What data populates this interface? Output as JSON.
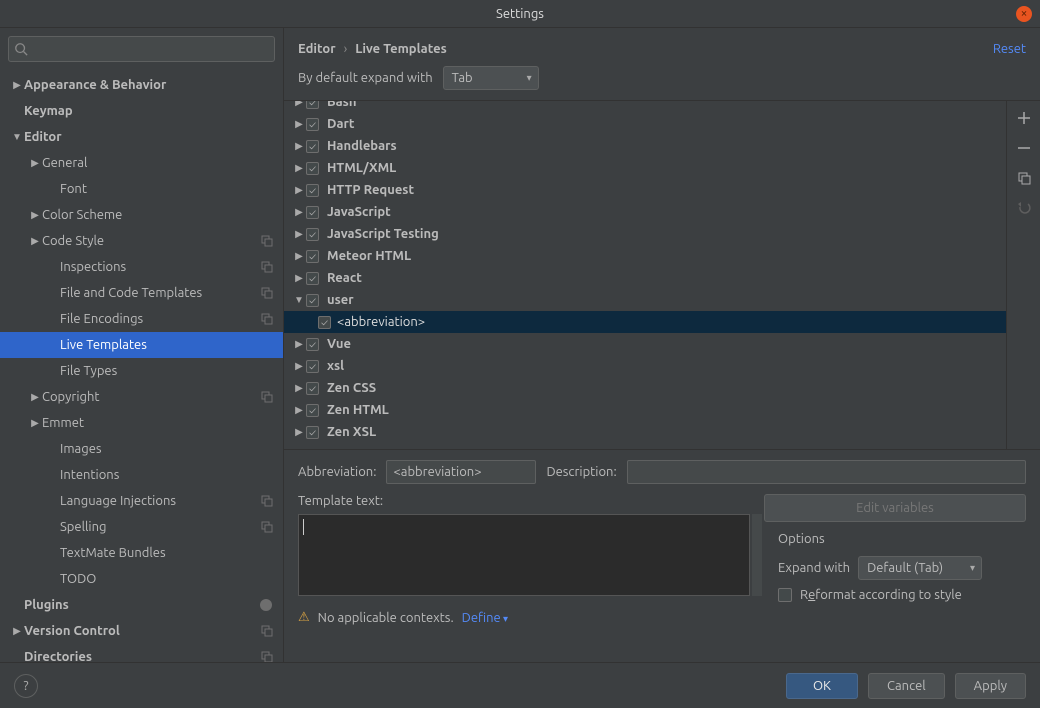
{
  "title": "Settings",
  "breadcrumb": {
    "a": "Editor",
    "b": "Live Templates",
    "reset": "Reset"
  },
  "expand_label": "By default expand with",
  "expand_value": "Tab",
  "sidebar": {
    "search_placeholder": "",
    "items": [
      {
        "label": "Appearance & Behavior",
        "level": 0,
        "arrow": "▶",
        "bold": true
      },
      {
        "label": "Keymap",
        "level": 0,
        "arrow": "",
        "bold": true
      },
      {
        "label": "Editor",
        "level": 0,
        "arrow": "▼",
        "bold": true
      },
      {
        "label": "General",
        "level": 1,
        "arrow": "▶"
      },
      {
        "label": "Font",
        "level": 2,
        "arrow": ""
      },
      {
        "label": "Color Scheme",
        "level": 1,
        "arrow": "▶"
      },
      {
        "label": "Code Style",
        "level": 1,
        "arrow": "▶",
        "copy": true
      },
      {
        "label": "Inspections",
        "level": 2,
        "arrow": "",
        "copy": true
      },
      {
        "label": "File and Code Templates",
        "level": 2,
        "arrow": "",
        "copy": true
      },
      {
        "label": "File Encodings",
        "level": 2,
        "arrow": "",
        "copy": true
      },
      {
        "label": "Live Templates",
        "level": 2,
        "arrow": "",
        "selected": true
      },
      {
        "label": "File Types",
        "level": 2,
        "arrow": ""
      },
      {
        "label": "Copyright",
        "level": 1,
        "arrow": "▶",
        "copy": true
      },
      {
        "label": "Emmet",
        "level": 1,
        "arrow": "▶"
      },
      {
        "label": "Images",
        "level": 2,
        "arrow": ""
      },
      {
        "label": "Intentions",
        "level": 2,
        "arrow": ""
      },
      {
        "label": "Language Injections",
        "level": 2,
        "arrow": "",
        "copy": true
      },
      {
        "label": "Spelling",
        "level": 2,
        "arrow": "",
        "copy": true
      },
      {
        "label": "TextMate Bundles",
        "level": 2,
        "arrow": ""
      },
      {
        "label": "TODO",
        "level": 2,
        "arrow": ""
      },
      {
        "label": "Plugins",
        "level": 0,
        "arrow": "",
        "bold": true,
        "badge": true
      },
      {
        "label": "Version Control",
        "level": 0,
        "arrow": "▶",
        "bold": true,
        "copy": true
      },
      {
        "label": "Directories",
        "level": 0,
        "arrow": "",
        "bold": true,
        "copy": true
      }
    ]
  },
  "groups": [
    {
      "name": "Bash",
      "arrow": "▶",
      "pad": true
    },
    {
      "name": "Dart",
      "arrow": "▶"
    },
    {
      "name": "Handlebars",
      "arrow": "▶"
    },
    {
      "name": "HTML/XML",
      "arrow": "▶"
    },
    {
      "name": "HTTP Request",
      "arrow": "▶"
    },
    {
      "name": "JavaScript",
      "arrow": "▶"
    },
    {
      "name": "JavaScript Testing",
      "arrow": "▶"
    },
    {
      "name": "Meteor HTML",
      "arrow": "▶"
    },
    {
      "name": "React",
      "arrow": "▶"
    },
    {
      "name": "user",
      "arrow": "▼",
      "items": [
        {
          "name": "<abbreviation>",
          "selected": true
        }
      ]
    },
    {
      "name": "Vue",
      "arrow": "▶"
    },
    {
      "name": "xsl",
      "arrow": "▶"
    },
    {
      "name": "Zen CSS",
      "arrow": "▶"
    },
    {
      "name": "Zen HTML",
      "arrow": "▶"
    },
    {
      "name": "Zen XSL",
      "arrow": "▶"
    }
  ],
  "fields": {
    "abbr_label": "Abbreviation:",
    "abbr_value": "<abbreviation>",
    "desc_label": "Description:",
    "desc_value": "",
    "tt_label": "Template text:",
    "edit_vars": "Edit variables",
    "options": "Options",
    "expand_with": "Expand with",
    "expand_with_value": "Default (Tab)",
    "reformat_pre": "R",
    "reformat_mid": "e",
    "reformat_post": "format according to style",
    "warn": "No applicable contexts.",
    "define": "Define"
  },
  "footer": {
    "ok": "OK",
    "cancel": "Cancel",
    "apply": "Apply"
  }
}
